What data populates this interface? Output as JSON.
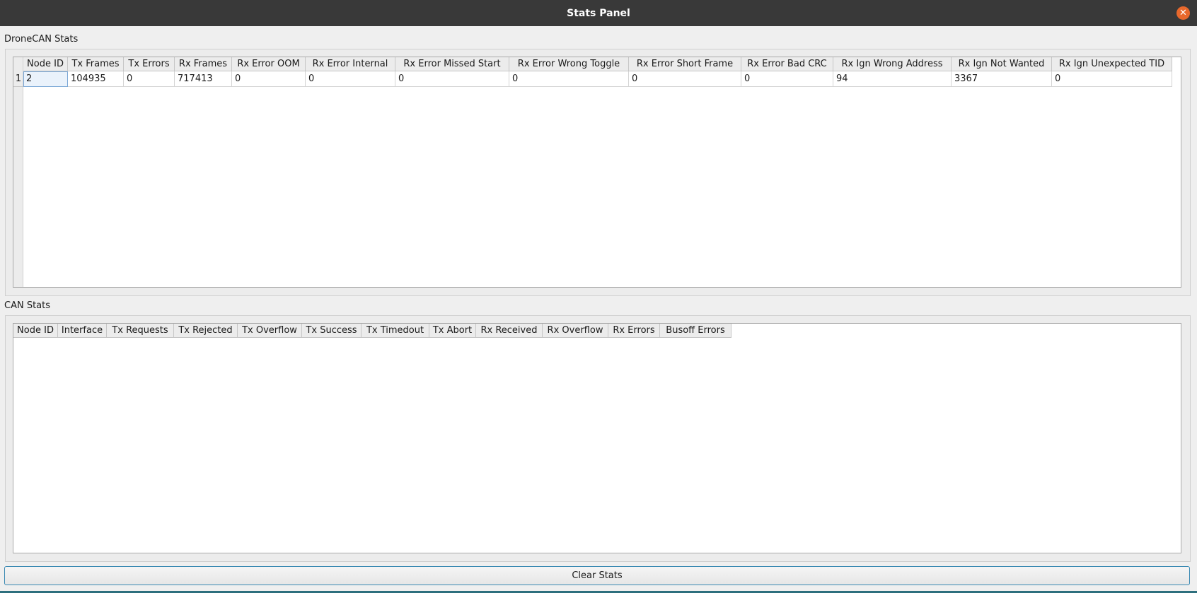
{
  "window": {
    "title": "Stats Panel",
    "close_glyph": "✕"
  },
  "dronecan": {
    "group_title": "DroneCAN Stats",
    "columns": [
      "Node ID",
      "Tx Frames",
      "Tx Errors",
      "Rx Frames",
      "Rx Error OOM",
      "Rx Error Internal",
      "Rx Error Missed Start",
      "Rx Error Wrong Toggle",
      "Rx Error Short Frame",
      "Rx Error Bad CRC",
      "Rx Ign Wrong Address",
      "Rx Ign Not Wanted",
      "Rx Ign Unexpected TID"
    ],
    "row_headers": [
      "1"
    ],
    "rows": [
      [
        "2",
        "104935",
        "0",
        "717413",
        "0",
        "0",
        "0",
        "0",
        "0",
        "0",
        "94",
        "3367",
        "0"
      ]
    ]
  },
  "can": {
    "group_title": "CAN Stats",
    "columns": [
      "Node ID",
      "Interface",
      "Tx Requests",
      "Tx Rejected",
      "Tx Overflow",
      "Tx Success",
      "Tx Timedout",
      "Tx Abort",
      "Rx Received",
      "Rx Overflow",
      "Rx Errors",
      "Busoff Errors"
    ],
    "rows": []
  },
  "footer": {
    "clear_label": "Clear Stats"
  },
  "colors": {
    "titlebar": "#393939",
    "close_button": "#e8682c",
    "button_border": "#3a89b3"
  }
}
